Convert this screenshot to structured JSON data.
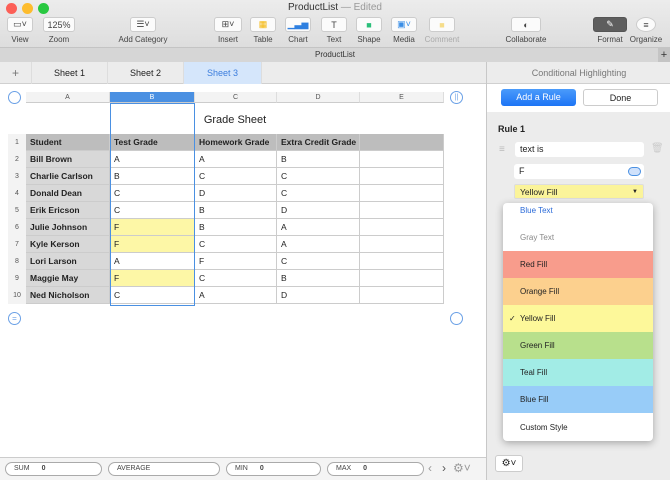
{
  "window": {
    "title": "ProductList",
    "status": "— Edited",
    "doc_title": "ProductList"
  },
  "toolbar": {
    "view": "View",
    "zoom_value": "125%",
    "zoom": "Zoom",
    "add_category": "Add Category",
    "insert": "Insert",
    "table": "Table",
    "chart": "Chart",
    "text": "Text",
    "shape": "Shape",
    "media": "Media",
    "comment": "Comment",
    "collaborate": "Collaborate",
    "format": "Format",
    "organize": "Organize"
  },
  "tabs": [
    "Sheet 1",
    "Sheet 2",
    "Sheet 3"
  ],
  "sheet": {
    "title": "Grade Sheet",
    "columns": [
      "A",
      "B",
      "C",
      "D",
      "E"
    ],
    "headers": [
      "Student",
      "Test Grade",
      "Homework Grade",
      "Extra Credit Grade"
    ],
    "rows": [
      [
        "Bill Brown",
        "A",
        "A",
        "B"
      ],
      [
        "Charlie Carlson",
        "B",
        "C",
        "C"
      ],
      [
        "Donald Dean",
        "C",
        "D",
        "C"
      ],
      [
        "Erik Ericson",
        "C",
        "B",
        "D"
      ],
      [
        "Julie Johnson",
        "F",
        "B",
        "A"
      ],
      [
        "Kyle Kerson",
        "F",
        "C",
        "A"
      ],
      [
        "Lori Larson",
        "A",
        "F",
        "C"
      ],
      [
        "Maggie May",
        "F",
        "C",
        "B"
      ],
      [
        "Ned Nicholson",
        "C",
        "A",
        "D"
      ]
    ],
    "highlight_color": "#fdf7a6"
  },
  "panel": {
    "title": "Conditional Highlighting",
    "add_rule": "Add a Rule",
    "done": "Done",
    "rule_label": "Rule 1",
    "condition": "text is",
    "value": "F",
    "style": "Yellow Fill"
  },
  "menu": [
    {
      "label": "Blue Text",
      "color": "#ffffff",
      "text": "#2a6ad8"
    },
    {
      "label": "Gray Text",
      "color": "#ffffff",
      "text": "#888888"
    },
    {
      "label": "Red Fill",
      "color": "#f89c8c"
    },
    {
      "label": "Orange Fill",
      "color": "#fcd08e"
    },
    {
      "label": "Yellow Fill",
      "color": "#fdf89a",
      "checked": true
    },
    {
      "label": "Green Fill",
      "color": "#b8e08c"
    },
    {
      "label": "Teal Fill",
      "color": "#a2ece6"
    },
    {
      "label": "Blue Fill",
      "color": "#98ccf8"
    },
    {
      "label": "Custom Style",
      "color": "#ffffff"
    }
  ],
  "status": {
    "sum": "SUM",
    "sum_v": "0",
    "avg": "AVERAGE",
    "min": "MIN",
    "min_v": "0",
    "max": "MAX",
    "max_v": "0"
  }
}
